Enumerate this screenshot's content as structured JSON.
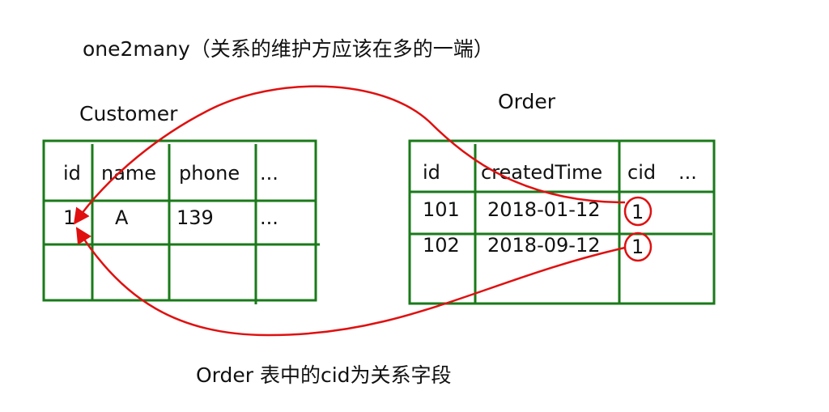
{
  "title": "one2many（关系的维护方应该在多的一端）",
  "customer": {
    "name": "Customer",
    "headers": [
      "id",
      "name",
      "phone",
      "..."
    ],
    "rows": [
      [
        "1",
        "A",
        "139",
        "..."
      ]
    ]
  },
  "order": {
    "name": "Order",
    "headers": [
      "id",
      "createdTime",
      "cid",
      "..."
    ],
    "rows": [
      [
        "101",
        "2018-01-12",
        "1"
      ],
      [
        "102",
        "2018-09-12",
        "1"
      ]
    ]
  },
  "caption": "Order 表中的cid为关系字段",
  "colors": {
    "grid": "#1a7a1a",
    "arrow": "#e01010"
  }
}
